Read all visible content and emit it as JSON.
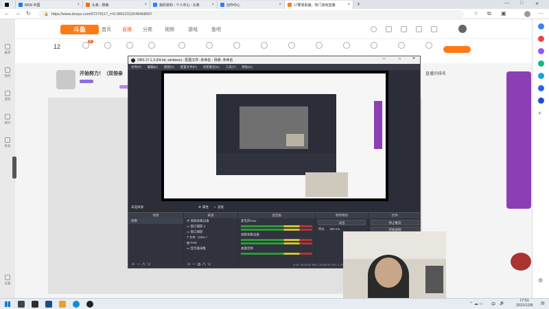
{
  "browser": {
    "tabs": [
      {
        "label": "MSN 中国",
        "color": "#1877f2"
      },
      {
        "label": "头条 - 搜索",
        "color": "#ff6a00"
      },
      {
        "label": "我的资料 - 个人中心 - 头条",
        "color": "#2a7fff"
      },
      {
        "label": "创作中心",
        "color": "#2a7fff"
      },
      {
        "label": "17要观看播，热门游戏直播",
        "color": "#ff7a15"
      }
    ],
    "url": "https://www.douyu.com/5727911?_r=0.06612152049468567"
  },
  "douyu": {
    "logo": "斗鱼",
    "nav": [
      "首页",
      "直播",
      "分类",
      "视频",
      "游戏",
      "鱼吧"
    ],
    "counter": "12",
    "room_title": "开始努力！（双倍亲",
    "sidebar_title": "直播间排名"
  },
  "obs": {
    "title": "OBS 27.1.3 (64-bit, windows) - 配置文件: 未命名 - 场景: 未命名",
    "menu": [
      "文件(F)",
      "编辑(E)",
      "视图(V)",
      "配置文件(P)",
      "场景集合(S)",
      "工具(T)",
      "帮助(H)"
    ],
    "no_source": "未选择源",
    "properties": "属性",
    "filters": "滤镜",
    "docks": {
      "scenes": "场景",
      "sources": "来源",
      "mixer": "混音器",
      "transitions": "转场特效",
      "controls": "控件"
    },
    "scene_items": [
      "场景"
    ],
    "source_items": [
      "视频采集设备",
      "窗口捕获 2",
      "窗口捕获",
      "文本（GDI+）",
      "FHD",
      "显示器采集"
    ],
    "mixer_items": [
      "麦克风/Aux",
      "视频采集设备",
      "桌面音频"
    ],
    "transition": "淡出",
    "transition_duration_label": "时长",
    "transition_duration": "300 ms",
    "controls": [
      "停止推流",
      "开始录制"
    ],
    "status": "LIVE: 00:00:00  REC: 00:00:00  CPU: 1.3%, 30.00 fps"
  },
  "taskbar": {
    "time": "17:51",
    "date": "2022/12/8",
    "lang": "中"
  }
}
